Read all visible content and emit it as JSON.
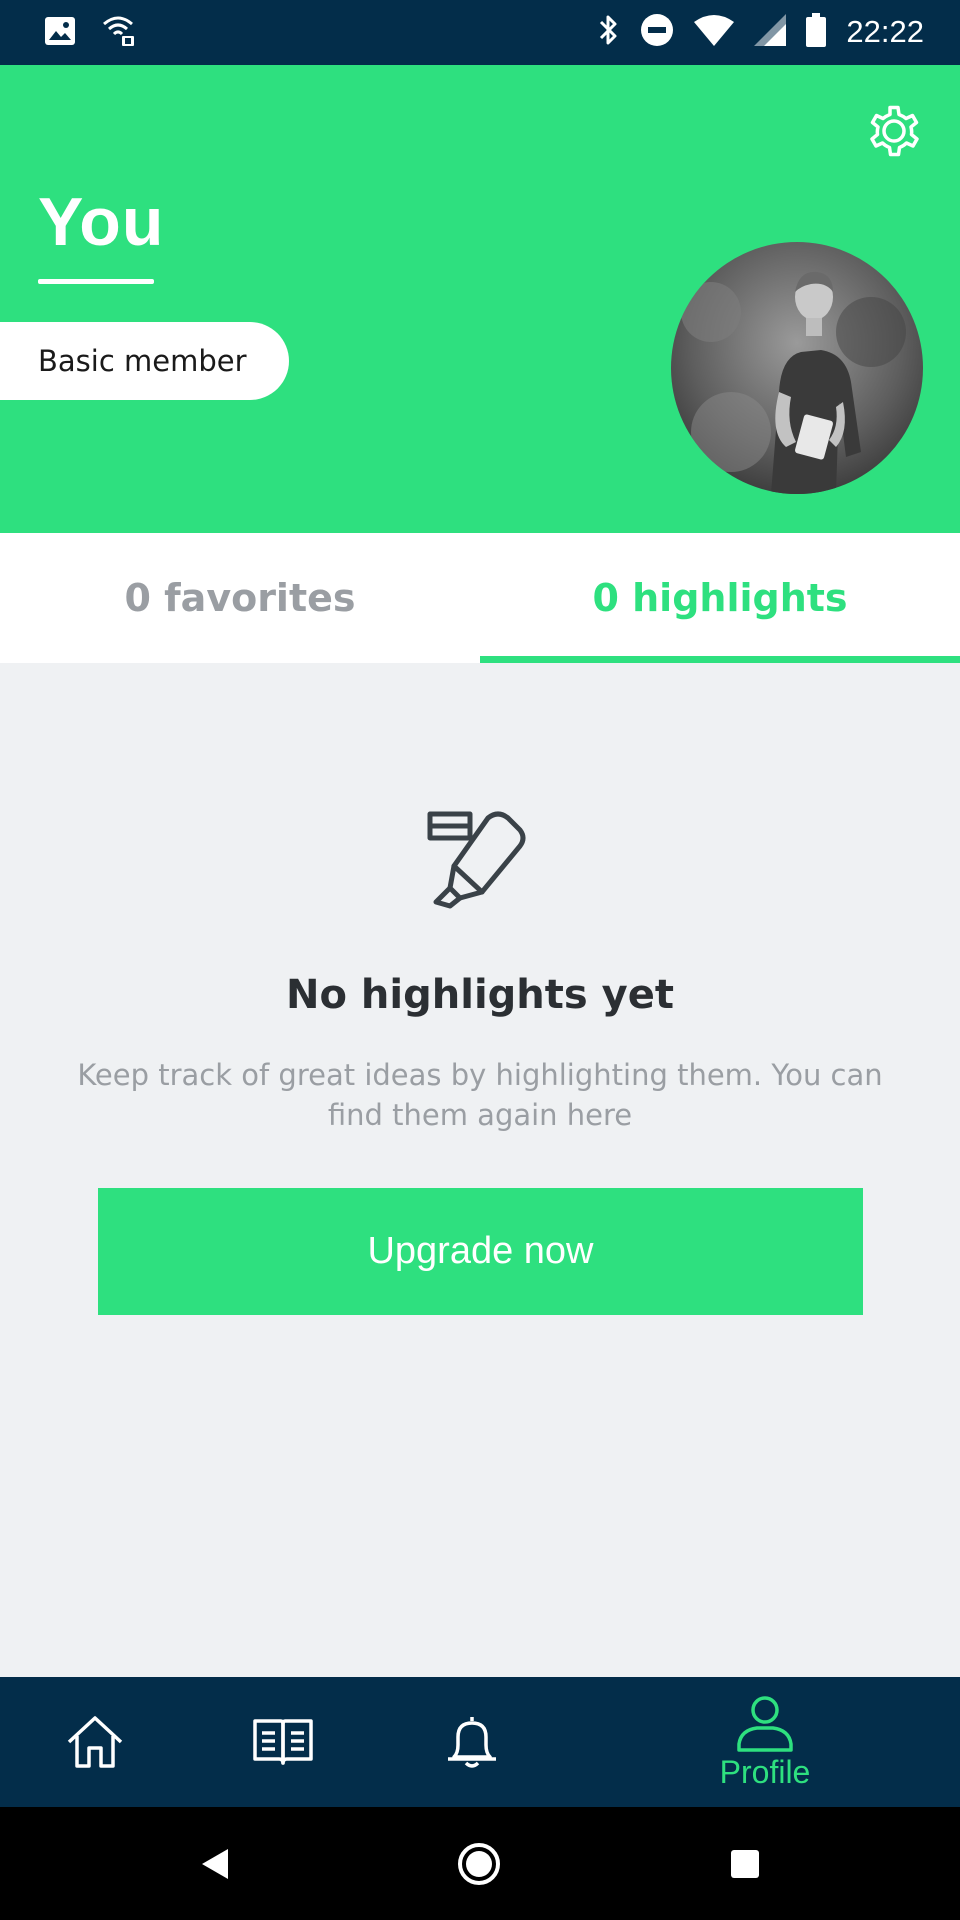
{
  "status_bar": {
    "time": "22:22",
    "icons": [
      "image-icon",
      "wifi-lock-icon",
      "bluetooth-icon",
      "do-not-disturb-icon",
      "wifi-icon",
      "signal-icon",
      "battery-icon"
    ]
  },
  "header": {
    "title": "You",
    "membership": "Basic member",
    "settings_icon": "gear-icon",
    "background_color": "#2ee07f"
  },
  "tabs": [
    {
      "label": "0 favorites",
      "active": false
    },
    {
      "label": "0 highlights",
      "active": true
    }
  ],
  "empty_state": {
    "icon": "highlighter-icon",
    "title": "No highlights yet",
    "description": "Keep track of great ideas by highlighting them. You can find them again here",
    "button_label": "Upgrade now"
  },
  "bottom_nav": {
    "items": [
      {
        "icon": "home-icon",
        "label": ""
      },
      {
        "icon": "book-icon",
        "label": ""
      },
      {
        "icon": "bell-icon",
        "label": ""
      },
      {
        "icon": "profile-icon",
        "label": "Profile",
        "active": true
      }
    ],
    "background_color": "#032d4a",
    "active_color": "#2ee07f"
  },
  "system_nav": [
    "back-icon",
    "home-circle-icon",
    "recents-icon"
  ]
}
